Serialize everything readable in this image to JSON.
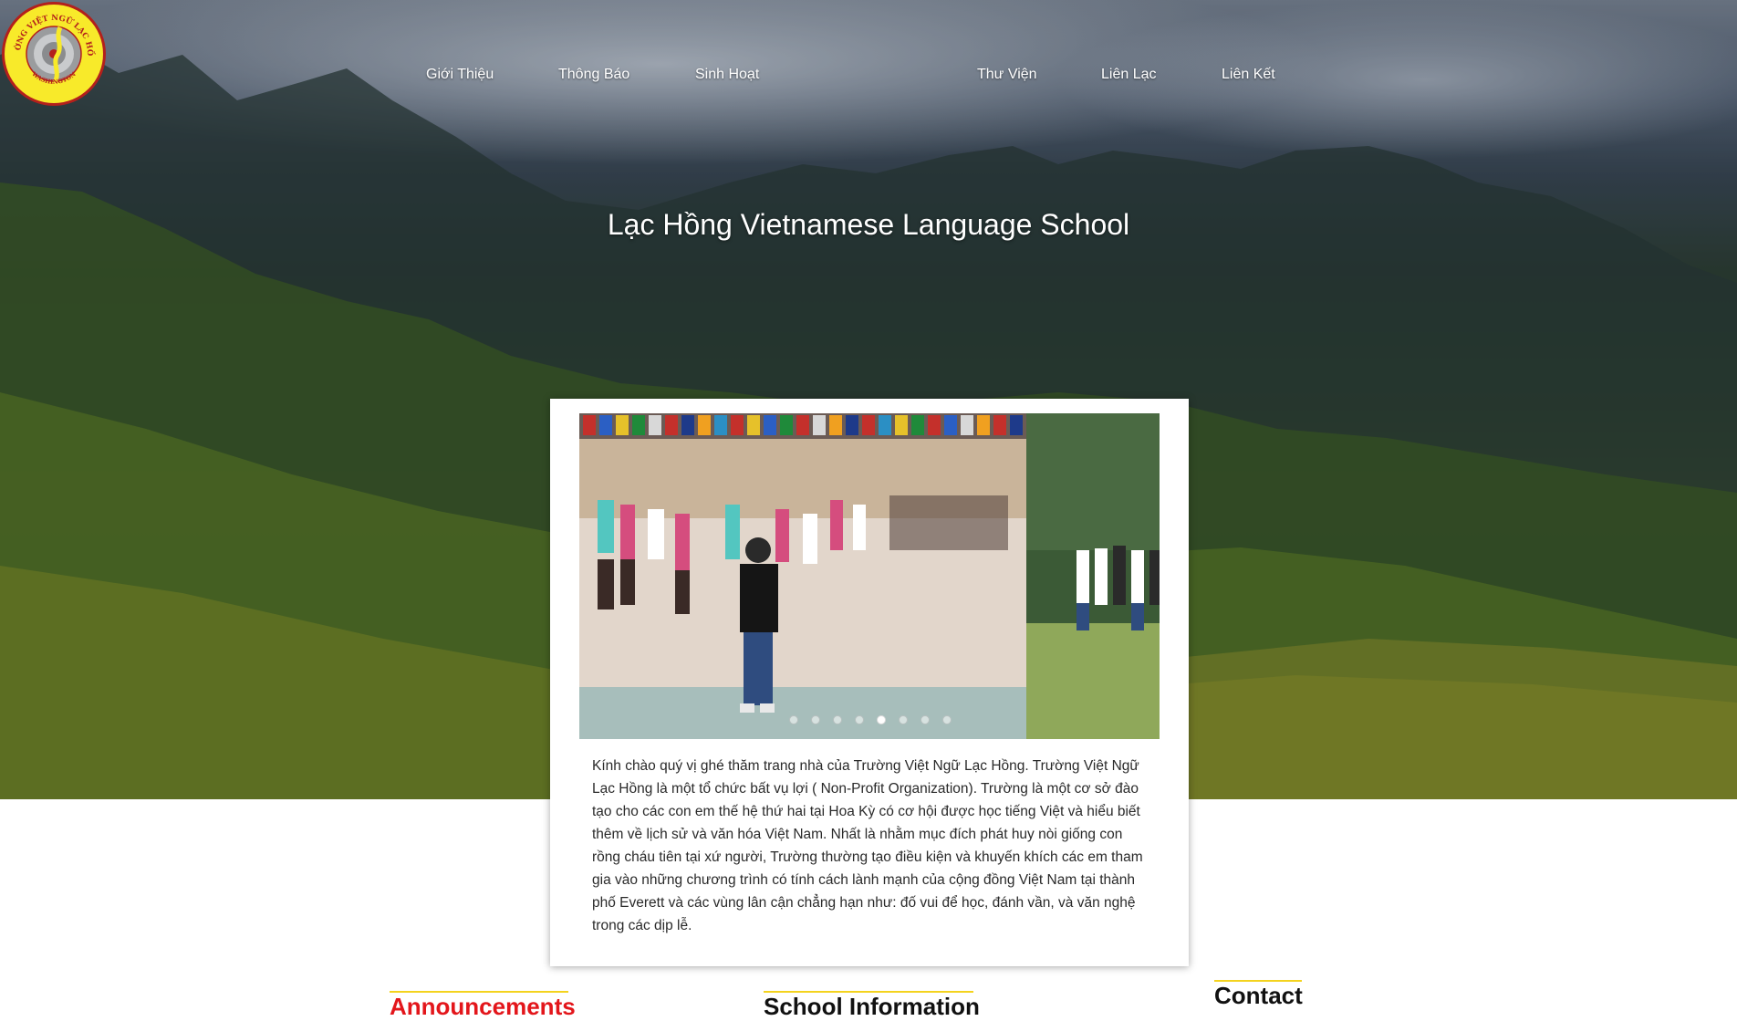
{
  "nav": {
    "left": [
      "Giới Thiệu",
      "Thông Báo",
      "Sinh Hoạt"
    ],
    "right": [
      "Thư Viện",
      "Liên Lạc",
      "Liên Kết"
    ]
  },
  "logo": {
    "ring_text": "TRƯỜNG VIỆT NGỮ LẠC HỒNG",
    "bottom_text": "WASHINGTON",
    "colors": {
      "fill": "#f8ea2a",
      "ring": "#b3201c"
    }
  },
  "hero": {
    "title": "Lạc Hồng Vietnamese Language School"
  },
  "slideshow": {
    "slide_count": 8,
    "active_index": 4
  },
  "intro": {
    "text": "Kính chào quý vị ghé thăm trang nhà của Trường Việt Ngữ Lạc Hồng. Trường Việt Ngữ Lạc Hồng là một tổ chức bất vụ lợi ( Non-Profit Organization). Trường là một cơ sở đào tạo cho các con em thế hệ thứ hai tại Hoa Kỳ có cơ hội được học tiếng Việt và hiểu biết thêm về lịch sử và văn hóa Việt Nam. Nhất là nhằm mục đích phát huy nòi giống con rồng cháu tiên tại xứ người, Trường thường tạo điều kiện và khuyến khích các em tham gia vào những chương trình có tính cách lành mạnh của cộng đồng Việt Nam tại thành phố Everett và các vùng lân cận chẳng hạn như: đố vui để học, đánh vần, và văn nghệ trong các dịp lễ."
  },
  "sections": {
    "announcements": "Announcements",
    "school_info": "School Information",
    "contact": "Contact"
  },
  "colors": {
    "accent": "#f4d31e",
    "announcement_heading": "#e3161b"
  }
}
